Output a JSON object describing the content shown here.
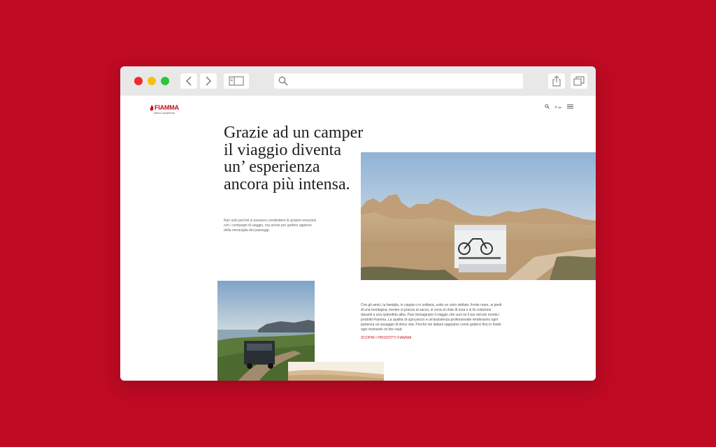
{
  "browser": {
    "url_placeholder": ""
  },
  "site": {
    "logo_text": "FIAMMA",
    "logo_tagline": "ideas & campervan",
    "lang": "it",
    "headline": "Grazie ad un camper il viaggio diventa un’ esperienza ancora più intensa.",
    "intro": "Non solo perché si possono condividere le proprie emozioni con i compagni di viaggio, ma anche per godere appieno della meraviglia dei paesaggi.",
    "body": "Con gli amici, la famiglia, in coppia o in solitaria, sotto un cielo stellato, fronte mare, ai piedi di una montagna, mentre si pranza al sacco, si cena al chiar di luna o si fa colazione davanti a una splendida alba. Puoi immaginare il viaggio che vuoi se il tuo veicolo monta i prodotti Fiamma. La qualità di ogni pezzo e un'assistenza professionale renderanno ogni partenza un assaggio di dolce vita. Perché noi italiani sappiamo come goderci fino in fondo ogni momento on the road.",
    "cta": "SCOPRI I PRODOTTI FIAMMA"
  },
  "colors": {
    "background": "#be0a23",
    "brand": "#c5101f"
  }
}
